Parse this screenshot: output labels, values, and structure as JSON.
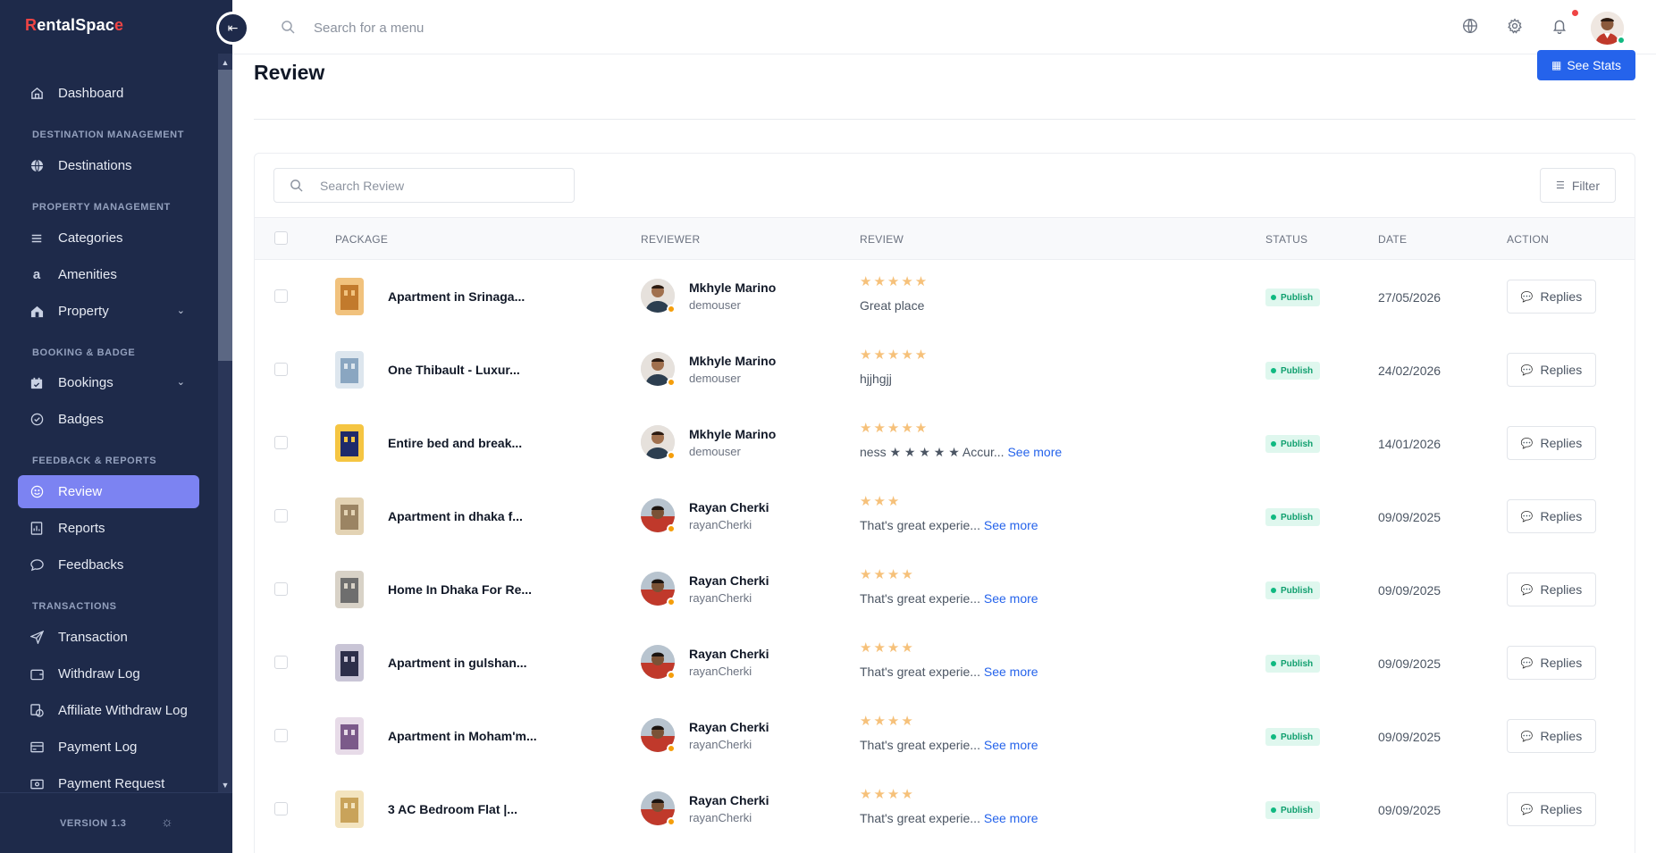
{
  "brand": {
    "name_prefix": "R",
    "name_mid": "entalSpac",
    "name_suffix": "e"
  },
  "sidebar": {
    "items": [
      {
        "label": "Dashboard",
        "icon": "home-icon"
      },
      {
        "label": "Destinations",
        "icon": "globe-icon"
      },
      {
        "label": "Categories",
        "icon": "list-icon"
      },
      {
        "label": "Amenities",
        "icon": "amenities-icon"
      },
      {
        "label": "Property",
        "icon": "property-icon"
      },
      {
        "label": "Bookings",
        "icon": "calendar-icon"
      },
      {
        "label": "Badges",
        "icon": "badge-icon"
      },
      {
        "label": "Review",
        "icon": "smile-icon"
      },
      {
        "label": "Reports",
        "icon": "report-icon"
      },
      {
        "label": "Feedbacks",
        "icon": "chat-icon"
      },
      {
        "label": "Transaction",
        "icon": "send-icon"
      },
      {
        "label": "Withdraw Log",
        "icon": "wallet-icon"
      },
      {
        "label": "Affiliate Withdraw Log",
        "icon": "affiliate-icon"
      },
      {
        "label": "Payment Log",
        "icon": "payment-icon"
      },
      {
        "label": "Payment Request",
        "icon": "money-icon"
      }
    ],
    "sections": [
      "DESTINATION MANAGEMENT",
      "PROPERTY MANAGEMENT",
      "BOOKING & BADGE",
      "FEEDBACK & REPORTS",
      "TRANSACTIONS"
    ],
    "version": "VERSION 1.3"
  },
  "topbar": {
    "search_placeholder": "Search for a menu"
  },
  "page": {
    "title": "Review",
    "see_stats_label": "See Stats"
  },
  "table": {
    "search_placeholder": "Search Review",
    "filter_label": "Filter",
    "headers": [
      "PACKAGE",
      "REVIEWER",
      "REVIEW",
      "STATUS",
      "DATE",
      "ACTION"
    ],
    "see_more_label": "See more",
    "replies_label": "Replies",
    "rows": [
      {
        "package": "Apartment in Srinaga...",
        "reviewer": "Mkhyle Marino",
        "username": "demouser",
        "stars": 5,
        "text": "Great place",
        "has_more": false,
        "status": "Publish",
        "date": "27/05/2026"
      },
      {
        "package": "One Thibault - Luxur...",
        "reviewer": "Mkhyle Marino",
        "username": "demouser",
        "stars": 5,
        "text": "hjjhgjj",
        "has_more": false,
        "status": "Publish",
        "date": "24/02/2026"
      },
      {
        "package": "Entire bed and break...",
        "reviewer": "Mkhyle Marino",
        "username": "demouser",
        "stars": 5,
        "text": "ness ★ ★ ★ ★ ★ Accur...",
        "has_more": true,
        "status": "Publish",
        "date": "14/01/2026"
      },
      {
        "package": "Apartment in dhaka f...",
        "reviewer": "Rayan Cherki",
        "username": "rayanCherki",
        "stars": 3,
        "text": "That's great experie...",
        "has_more": true,
        "status": "Publish",
        "date": "09/09/2025"
      },
      {
        "package": "Home In Dhaka For Re...",
        "reviewer": "Rayan Cherki",
        "username": "rayanCherki",
        "stars": 4,
        "text": "That's great experie...",
        "has_more": true,
        "status": "Publish",
        "date": "09/09/2025"
      },
      {
        "package": "Apartment in gulshan...",
        "reviewer": "Rayan Cherki",
        "username": "rayanCherki",
        "stars": 4,
        "text": "That's great experie...",
        "has_more": true,
        "status": "Publish",
        "date": "09/09/2025"
      },
      {
        "package": "Apartment in Moham'm...",
        "reviewer": "Rayan Cherki",
        "username": "rayanCherki",
        "stars": 4,
        "text": "That's great experie...",
        "has_more": true,
        "status": "Publish",
        "date": "09/09/2025"
      },
      {
        "package": "3 AC Bedroom Flat |...",
        "reviewer": "Rayan Cherki",
        "username": "rayanCherki",
        "stars": 4,
        "text": "That's great experie...",
        "has_more": true,
        "status": "Publish",
        "date": "09/09/2025"
      }
    ]
  },
  "colors": {
    "sidebar_bg": "#1e2a4a",
    "active_item": "#7c83f2",
    "primary": "#2563eb",
    "star": "#f6c17a",
    "publish_bg": "#dff7ee",
    "publish_text": "#0f9f6e"
  }
}
